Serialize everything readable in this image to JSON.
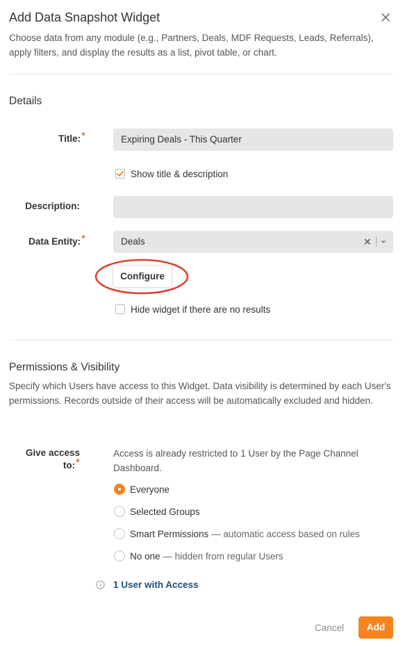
{
  "modal": {
    "title": "Add Data Snapshot Widget",
    "description": "Choose data from any module (e.g., Partners, Deals, MDF Requests, Leads, Referrals), apply filters, and display the results as a list, pivot table, or chart."
  },
  "details": {
    "heading": "Details",
    "title_label": "Title:",
    "title_value": "Expiring Deals - This Quarter",
    "show_title_label": "Show title & description",
    "show_title_checked": true,
    "description_label": "Description:",
    "description_value": "",
    "entity_label": "Data Entity:",
    "entity_value": "Deals",
    "configure_label": "Configure",
    "hide_widget_label": "Hide widget if there are no results",
    "hide_widget_checked": false,
    "required_mark": "*"
  },
  "permissions": {
    "heading": "Permissions & Visibility",
    "description": "Specify which Users have access to this Widget. Data visibility is determined by each User's permissions. Records outside of their access will be automatically excluded and hidden.",
    "give_access_label": "Give access to:",
    "access_note": "Access is already restricted to 1 User by the Page Channel Dashboard.",
    "options": [
      {
        "label": "Everyone",
        "sub": "",
        "selected": true
      },
      {
        "label": "Selected Groups",
        "sub": "",
        "selected": false
      },
      {
        "label": "Smart Permissions",
        "sub": "— automatic access based on rules",
        "selected": false
      },
      {
        "label": "No one",
        "sub": "— hidden from regular Users",
        "selected": false
      }
    ],
    "users_link": "1 User with Access"
  },
  "footer": {
    "cancel_label": "Cancel",
    "add_label": "Add"
  },
  "colors": {
    "accent": "#f5841f",
    "required": "#e0402c",
    "link": "#1f4e79",
    "callout": "#d9422f"
  },
  "icons": {
    "close": "close-icon",
    "check": "checkmark-icon",
    "clear": "clear-x-icon",
    "caret": "chevron-down-icon",
    "info": "info-icon"
  }
}
